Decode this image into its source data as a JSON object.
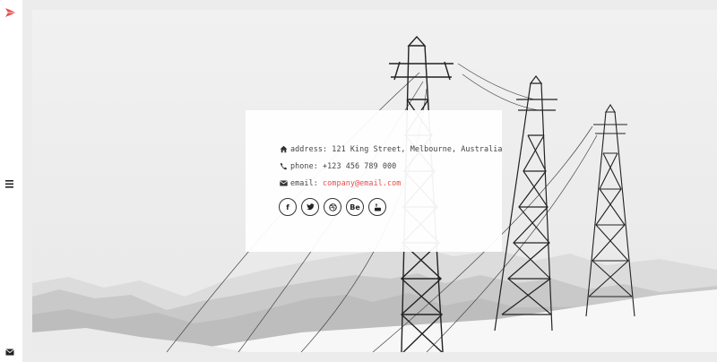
{
  "icons": {
    "logo": "red-arrow-logo-icon",
    "menu": "hamburger-menu-icon",
    "mail": "envelope-icon",
    "address": "home-icon",
    "phone": "phone-icon",
    "email": "envelope-icon"
  },
  "colors": {
    "accent": "#e94b4b",
    "background": "#ececec",
    "text": "#444444"
  },
  "contact": {
    "address_label": "address:",
    "address_value": "121 King Street, Melbourne, Australia",
    "phone_label": "phone:",
    "phone_value": "+123 456 789 000",
    "email_label": "email:",
    "email_value": "company@email.com"
  },
  "social": [
    {
      "name": "facebook",
      "glyph": "f"
    },
    {
      "name": "twitter",
      "glyph": ""
    },
    {
      "name": "dribbble",
      "glyph": ""
    },
    {
      "name": "behance",
      "glyph": "Be"
    },
    {
      "name": "youtube",
      "glyph": ""
    }
  ]
}
